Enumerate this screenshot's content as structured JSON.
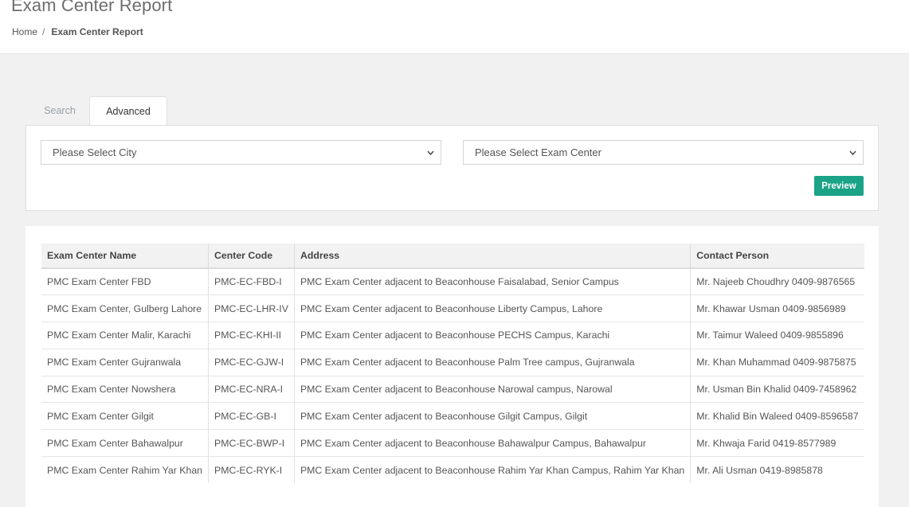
{
  "page": {
    "title": "Exam Center Report",
    "breadcrumb": {
      "home": "Home",
      "separator": "/",
      "current": "Exam Center Report"
    }
  },
  "tabs": [
    {
      "label": "Search",
      "active": false
    },
    {
      "label": "Advanced",
      "active": true
    }
  ],
  "filters": {
    "city_select": "Please Select City",
    "center_select": "Please Select Exam Center",
    "preview_label": "Preview"
  },
  "colors": {
    "accent": "#1aa386",
    "background": "#f1f1f1"
  },
  "table": {
    "headers": [
      "Exam Center Name",
      "Center Code",
      "Address",
      "Contact Person"
    ],
    "rows": [
      [
        "PMC Exam Center FBD",
        "PMC-EC-FBD-I",
        "PMC Exam Center adjacent to Beaconhouse Faisalabad, Senior Campus",
        "Mr. Najeeb Choudhry 0409-9876565"
      ],
      [
        "PMC Exam Center, Gulberg Lahore",
        "PMC-EC-LHR-IV",
        "PMC Exam Center adjacent to Beaconhouse Liberty Campus, Lahore",
        "Mr. Khawar Usman 0409-9856989"
      ],
      [
        "PMC Exam Center Malir, Karachi",
        "PMC-EC-KHI-II",
        "PMC Exam Center adjacent to Beaconhouse PECHS Campus, Karachi",
        "Mr. Taimur Waleed 0409-9855896"
      ],
      [
        "PMC Exam Center Gujranwala",
        "PMC-EC-GJW-I",
        "PMC Exam Center adjacent to Beaconhouse Palm Tree campus, Gujranwala",
        "Mr. Khan Muhammad 0409-9875875"
      ],
      [
        "PMC Exam Center Nowshera",
        "PMC-EC-NRA-I",
        "PMC Exam Center adjacent to Beaconhouse Narowal campus, Narowal",
        "Mr. Usman Bin Khalid 0409-7458962"
      ],
      [
        "PMC Exam Center Gilgit",
        "PMC-EC-GB-I",
        "PMC Exam Center adjacent to Beaconhouse Gilgit Campus, Gilgit",
        "Mr. Khalid Bin Waleed 0409-8596587"
      ],
      [
        "PMC Exam Center Bahawalpur",
        "PMC-EC-BWP-I",
        "PMC Exam Center adjacent to Beaconhouse Bahawalpur Campus, Bahawalpur",
        "Mr. Khwaja Farid 0419-8577989"
      ],
      [
        "PMC Exam Center Rahim Yar Khan",
        "PMC-EC-RYK-I",
        "PMC Exam Center adjacent to Beaconhouse Rahim Yar Khan Campus, Rahim Yar Khan",
        "Mr. Ali Usman 0419-8985878"
      ]
    ]
  }
}
